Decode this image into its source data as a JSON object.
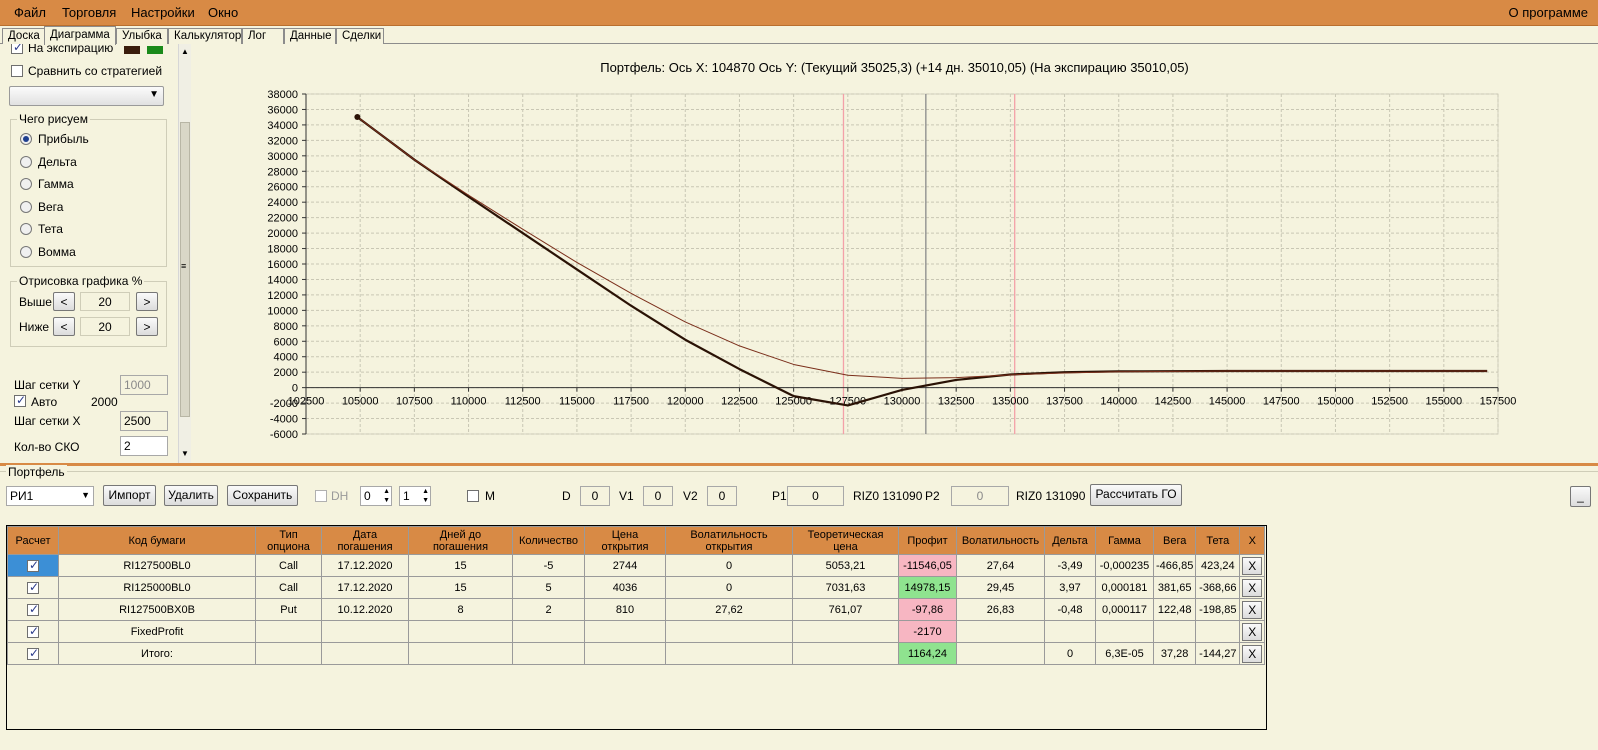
{
  "menu": {
    "items": [
      "Файл",
      "Торговля",
      "Настройки",
      "Окно"
    ],
    "about": "О программе"
  },
  "tabs": [
    "Доска",
    "Диаграмма",
    "Улыбка",
    "Калькулятор",
    "Лог",
    "Данные",
    "Сделки"
  ],
  "active_tab": "Диаграмма",
  "left": {
    "expiry_label": "На экспирацию",
    "expiry_checked": true,
    "compare_label": "Сравнить со стратегией",
    "compare_checked": false,
    "what_draw_title": "Чего рисуем",
    "radios": [
      "Прибыль",
      "Дельта",
      "Гамма",
      "Вега",
      "Тета",
      "Вомма"
    ],
    "radio_selected": "Прибыль",
    "render_title": "Отрисовка графика %",
    "above_label": "Выше",
    "above_value": "20",
    "below_label": "Ниже",
    "below_value": "20",
    "minus_glyph": "<",
    "plus_glyph": ">",
    "grid_y_label": "Шаг сетки Y",
    "grid_y_value": "1000",
    "auto_label": "Авто",
    "auto_checked": true,
    "auto_value": "2000",
    "grid_x_label": "Шаг сетки X",
    "grid_x_value": "2500",
    "sko_label": "Кол-во СКО",
    "sko_value": "2",
    "colors": {
      "swatch1": "#3a1d0c",
      "swatch2": "#1a8a1a"
    }
  },
  "chart_title": "Портфель: Ось X:  104870 Ось Y:   (Текущий  35025,3)   (+14 дн.  35010,05)   (На экспирацию 35010,05)",
  "chart_data": {
    "type": "line",
    "xlim": [
      102500,
      157500
    ],
    "ylim": [
      -6000,
      38000
    ],
    "x_ticks": [
      102500,
      105000,
      107500,
      110000,
      112500,
      115000,
      117500,
      120000,
      122500,
      125000,
      127500,
      130000,
      132500,
      135000,
      137500,
      140000,
      142500,
      145000,
      147500,
      150000,
      152500,
      155000,
      157500
    ],
    "y_ticks": [
      -6000,
      -4000,
      -2000,
      0,
      2000,
      4000,
      6000,
      8000,
      10000,
      12000,
      14000,
      16000,
      18000,
      20000,
      22000,
      24000,
      26000,
      28000,
      30000,
      32000,
      34000,
      36000,
      38000
    ],
    "grid": true,
    "vertical_lines": [
      {
        "x": 127300,
        "color": "#f4a0a8"
      },
      {
        "x": 131100,
        "color": "#8a8a8a"
      },
      {
        "x": 135200,
        "color": "#f4a0a8"
      }
    ],
    "series": [
      {
        "color": "#2a1205",
        "width": 2.2,
        "x": [
          104870,
          107500,
          110000,
          112500,
          115000,
          117500,
          120000,
          122500,
          125000,
          127500,
          130000,
          132500,
          135000,
          137500,
          140000,
          145000,
          150000,
          157000
        ],
        "y": [
          35010,
          29500,
          24700,
          20000,
          15300,
          10600,
          6200,
          2400,
          -1100,
          -2300,
          -300,
          1000,
          1700,
          2000,
          2100,
          2150,
          2150,
          2150
        ]
      },
      {
        "color": "#7a2e1a",
        "width": 1,
        "x": [
          104870,
          107500,
          110000,
          112500,
          115000,
          117500,
          120000,
          122500,
          125000,
          127500,
          130000,
          132500,
          135000,
          137500,
          140000,
          145000,
          150000,
          157000
        ],
        "y": [
          35025,
          29500,
          24900,
          20500,
          16200,
          12200,
          8500,
          5400,
          3000,
          1600,
          1200,
          1300,
          1650,
          1900,
          2050,
          2150,
          2150,
          2150
        ]
      }
    ],
    "marker": {
      "x": 104870,
      "y": 35025
    }
  },
  "portfolio": {
    "title": "Портфель",
    "name": "РИ1",
    "import_label": "Импорт",
    "delete_label": "Удалить",
    "save_label": "Сохранить",
    "dh_label": "DH",
    "dh_val1": "0",
    "dh_val2": "1",
    "m_label": "M",
    "d_label": "D",
    "d_value": "0",
    "v1_label": "V1",
    "v1_value": "0",
    "v2_label": "V2",
    "v2_value": "0",
    "p1_label": "P1",
    "p1_value": "0",
    "p1_code": "RIZ0 131090",
    "p2_label": "P2",
    "p2_value": "0",
    "p2_code": "RIZ0 131090",
    "calc_label": "Рассчитать ГО",
    "min_label": "_"
  },
  "table": {
    "headers": [
      "Расчет",
      "Код бумаги",
      "Тип опциона",
      "Дата погашения",
      "Дней до погашения",
      "Количество",
      "Цена открытия",
      "Волатильность открытия",
      "Теоретическая цена",
      "Профит",
      "Волатильность",
      "Дельта",
      "Гамма",
      "Вега",
      "Тета",
      "X"
    ],
    "rows": [
      [
        "RI127500BL0",
        "Call",
        "17.12.2020",
        "15",
        "-5",
        "2744",
        "0",
        "5053,21",
        "-11546,05",
        "27,64",
        "-3,49",
        "-0,000235",
        "-466,85",
        "423,24",
        "X"
      ],
      [
        "RI125000BL0",
        "Call",
        "17.12.2020",
        "15",
        "5",
        "4036",
        "0",
        "7031,63",
        "14978,15",
        "29,45",
        "3,97",
        "0,000181",
        "381,65",
        "-368,66",
        "X"
      ],
      [
        "RI127500BX0B",
        "Put",
        "10.12.2020",
        "8",
        "2",
        "810",
        "27,62",
        "761,07",
        "-97,86",
        "26,83",
        "-0,48",
        "0,000117",
        "122,48",
        "-198,85",
        "X"
      ],
      [
        "FixedProfit",
        "",
        "",
        "",
        "",
        "",
        "",
        "",
        "-2170",
        "",
        "",
        "",
        "",
        "",
        "X"
      ],
      [
        "Итого:",
        "",
        "",
        "",
        "",
        "",
        "",
        "",
        "1164,24",
        "",
        "0",
        "6,3E-05",
        "37,28",
        "-144,27",
        "X"
      ]
    ]
  }
}
